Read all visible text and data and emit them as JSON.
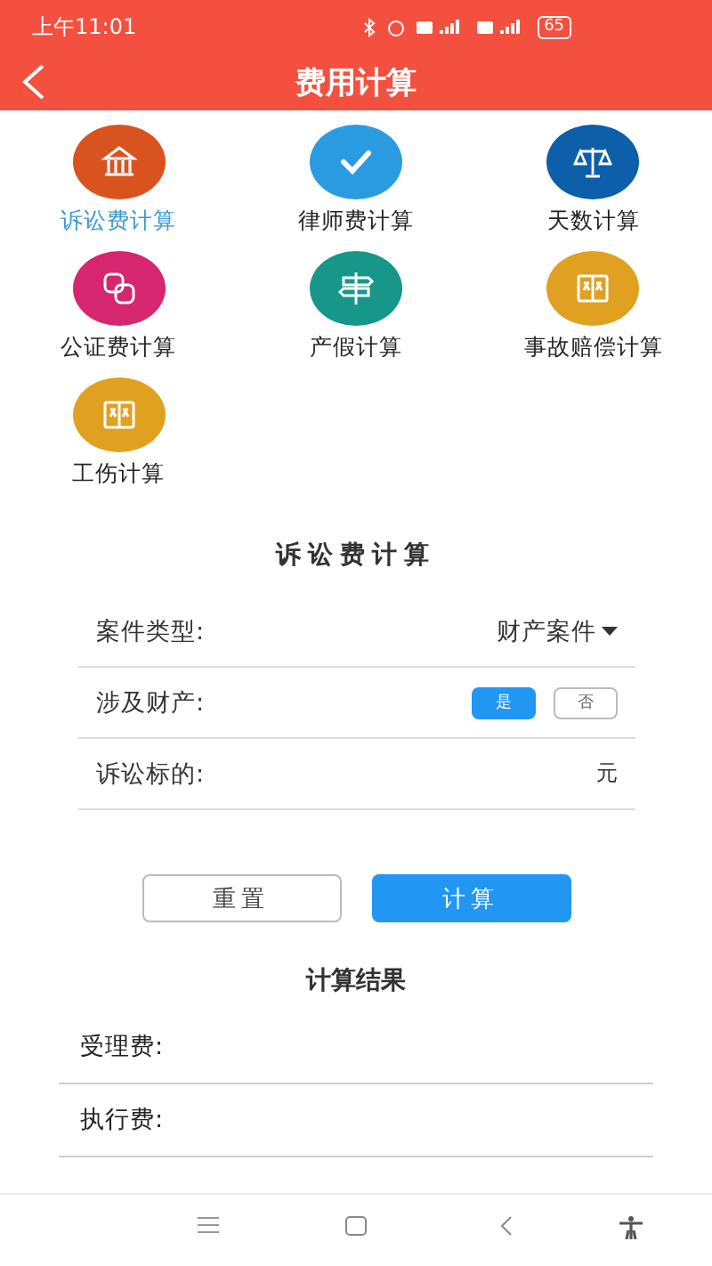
{
  "status_bar": {
    "time": "上午11:01",
    "battery": "65"
  },
  "header": {
    "title": "费用计算"
  },
  "calculators": [
    {
      "label": "诉讼费计算",
      "kind": "bank",
      "color": "#d9531e",
      "selected": true
    },
    {
      "label": "律师费计算",
      "kind": "check",
      "color": "#2a9be0",
      "selected": false
    },
    {
      "label": "天数计算",
      "kind": "scales",
      "color": "#0c5fa8",
      "selected": false
    },
    {
      "label": "公证费计算",
      "kind": "squares",
      "color": "#d6266f",
      "selected": false
    },
    {
      "label": "产假计算",
      "kind": "signpost",
      "color": "#17978a",
      "selected": false
    },
    {
      "label": "事故赔偿计算",
      "kind": "book",
      "color": "#e0a020",
      "selected": false
    },
    {
      "label": "工伤计算",
      "kind": "book",
      "color": "#e0a020",
      "selected": false
    }
  ],
  "form": {
    "title": "诉讼费计算",
    "rows": [
      {
        "kind": "select",
        "label": "案件类型:",
        "value": "财产案件"
      },
      {
        "kind": "toggle",
        "label": "涉及财产:",
        "options": [
          {
            "label": "是",
            "selected": true
          },
          {
            "label": "否",
            "selected": false
          }
        ]
      },
      {
        "kind": "input",
        "label": "诉讼标的:",
        "unit": "元"
      }
    ],
    "buttons": [
      {
        "label": "重置",
        "kind": "secondary"
      },
      {
        "label": "计算",
        "kind": "primary"
      }
    ]
  },
  "results": {
    "title": "计算结果",
    "rows": [
      {
        "label": "受理费:"
      },
      {
        "label": "执行费:"
      }
    ]
  }
}
